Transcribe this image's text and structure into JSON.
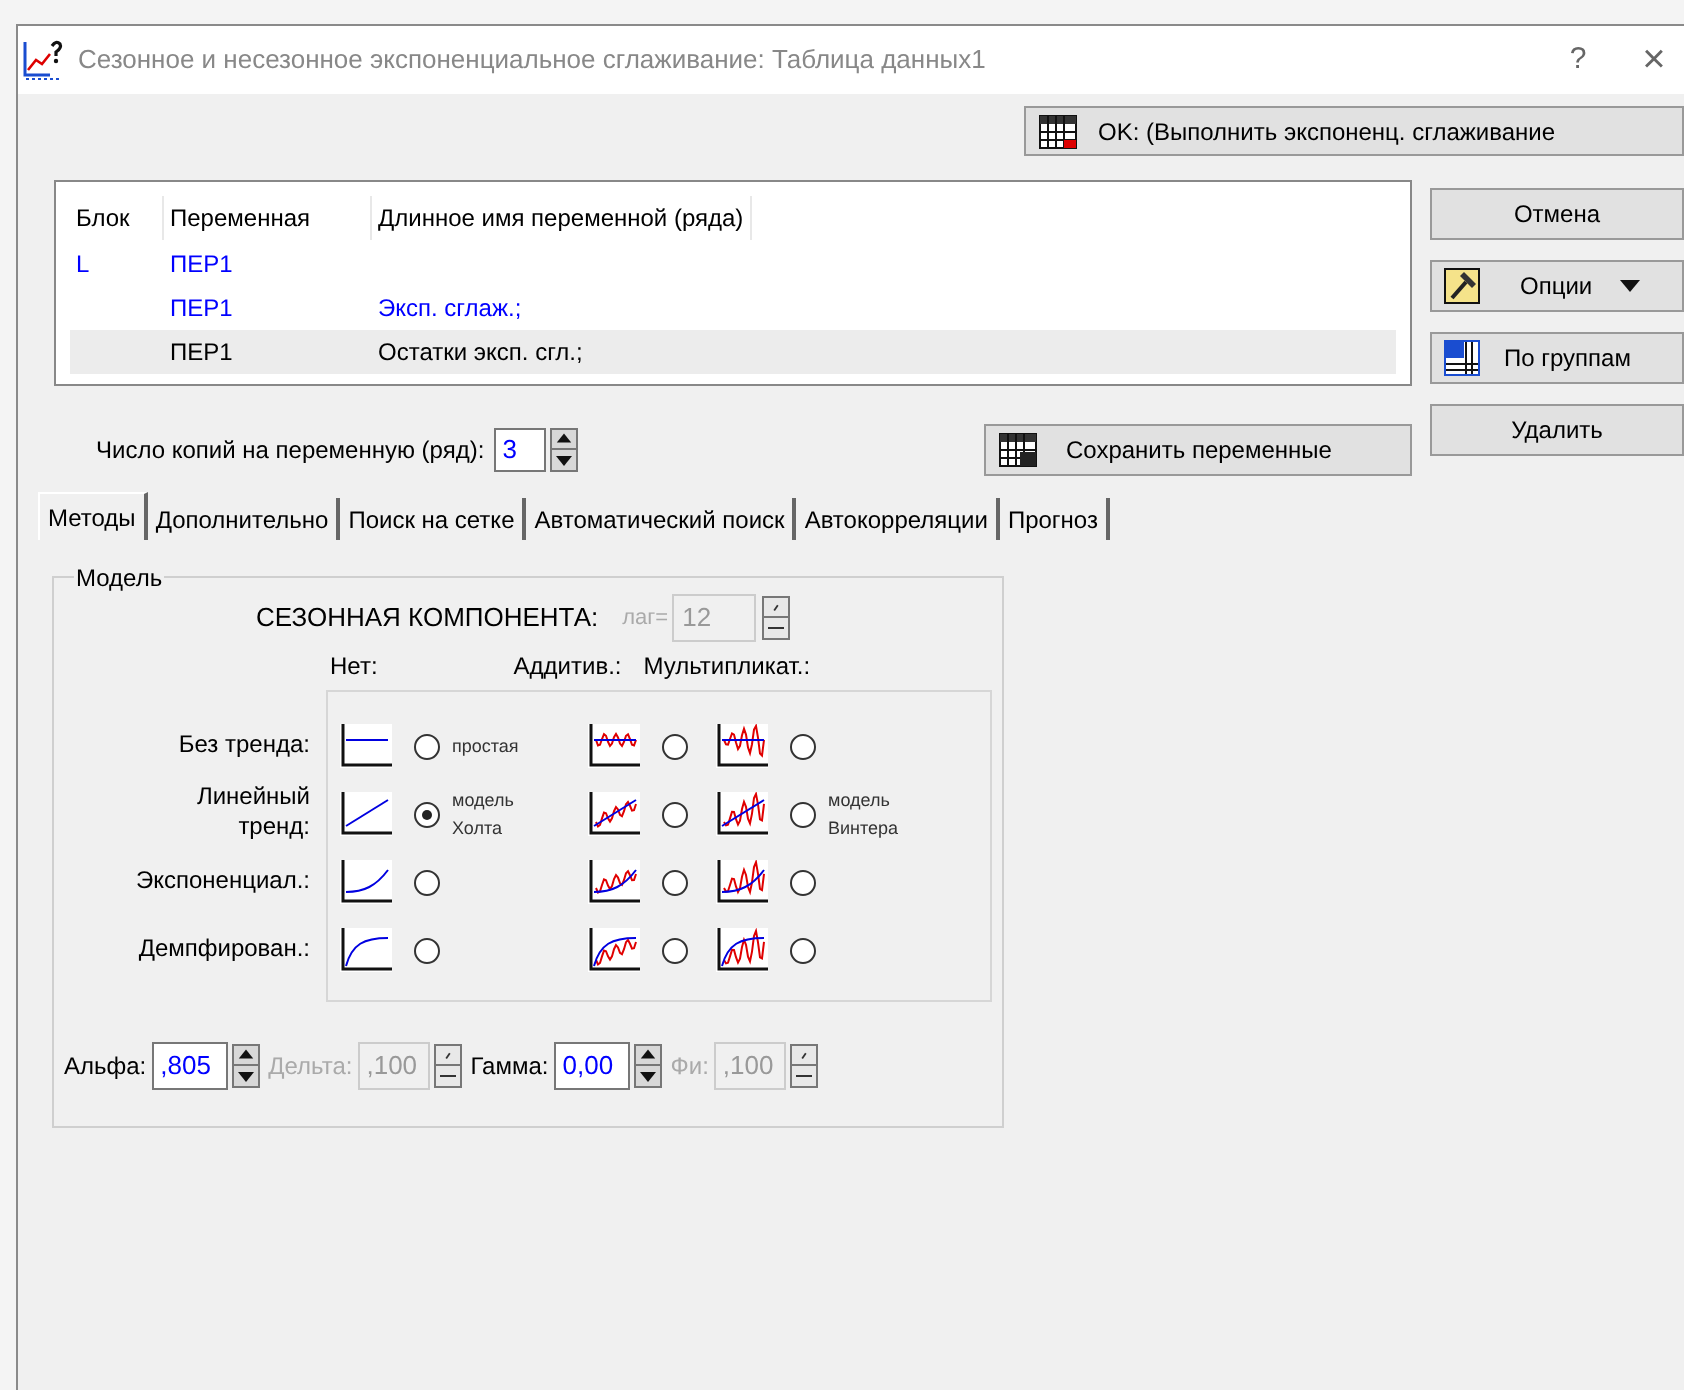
{
  "window": {
    "title": "Сезонное и несезонное экспоненциальное сглаживание: Таблица данных1",
    "help": "?",
    "close": "×"
  },
  "ok_button": "OK: (Выполнить экспоненц. сглаживание",
  "table": {
    "columns": [
      "Блок",
      "Переменная",
      "Длинное имя переменной (ряда)"
    ],
    "rows": [
      {
        "block": "L",
        "variable": "ПЕР1",
        "color": "#0000ff",
        "selected": false
      },
      {
        "variable": "ПЕР1",
        "long_name": "Эксп. сглаж.;",
        "color": "#0000ff",
        "selected": false
      },
      {
        "variable": "ПЕР1",
        "long_name": "Остатки эксп. сгл.;",
        "color": "#000000",
        "selected": true
      }
    ]
  },
  "side_buttons": [
    {
      "label": "Отмена",
      "kind": "plain"
    },
    {
      "label": "Опции",
      "kind": "options"
    },
    {
      "label": "По группам",
      "kind": "groups"
    },
    {
      "label": "Удалить",
      "kind": "plain"
    }
  ],
  "copies": {
    "label": "Число копий на переменную (ряд):",
    "value": "3"
  },
  "save_button": "Сохранить переменные",
  "tabs": [
    {
      "label": "Методы",
      "selected": true
    },
    {
      "label": "Дополнительно",
      "selected": false
    },
    {
      "label": "Поиск на сетке",
      "selected": false
    },
    {
      "label": "Автоматический поиск",
      "selected": false
    },
    {
      "label": "Автокорреляции",
      "selected": false
    },
    {
      "label": "Прогноз",
      "selected": false
    }
  ],
  "model": {
    "title": "Модель",
    "seasonal_label": "СЕЗОННАЯ КОМПОНЕНТА:",
    "lag": {
      "label": "лаг=",
      "value": "12",
      "disabled": true
    },
    "column_headers": [
      "Нет:",
      "Аддитив.:",
      "Мультипликат.:"
    ],
    "rows": [
      {
        "label": "Без тренда:",
        "kind": "none",
        "options": [
          {
            "selected": false,
            "note": "простая"
          },
          {
            "selected": false
          },
          {
            "selected": false
          }
        ]
      },
      {
        "label": "Линейный тренд:",
        "kind": "linear",
        "options": [
          {
            "selected": true,
            "note": "модель Холта"
          },
          {
            "selected": false
          },
          {
            "selected": false,
            "note": "модель Винтера"
          }
        ]
      },
      {
        "label": "Экспоненциал.:",
        "kind": "exponential",
        "options": [
          {
            "selected": false
          },
          {
            "selected": false
          },
          {
            "selected": false
          }
        ]
      },
      {
        "label": "Демпфирован.:",
        "kind": "damped",
        "options": [
          {
            "selected": false
          },
          {
            "selected": false
          },
          {
            "selected": false
          }
        ]
      }
    ]
  },
  "params": [
    {
      "label": "Альфа:",
      "value": ",805",
      "disabled": false
    },
    {
      "label": "Дельта:",
      "value": ",100",
      "disabled": true
    },
    {
      "label": "Гамма:",
      "value": "0,00",
      "disabled": false
    },
    {
      "label": "Фи:",
      "value": ",100",
      "disabled": true
    }
  ]
}
